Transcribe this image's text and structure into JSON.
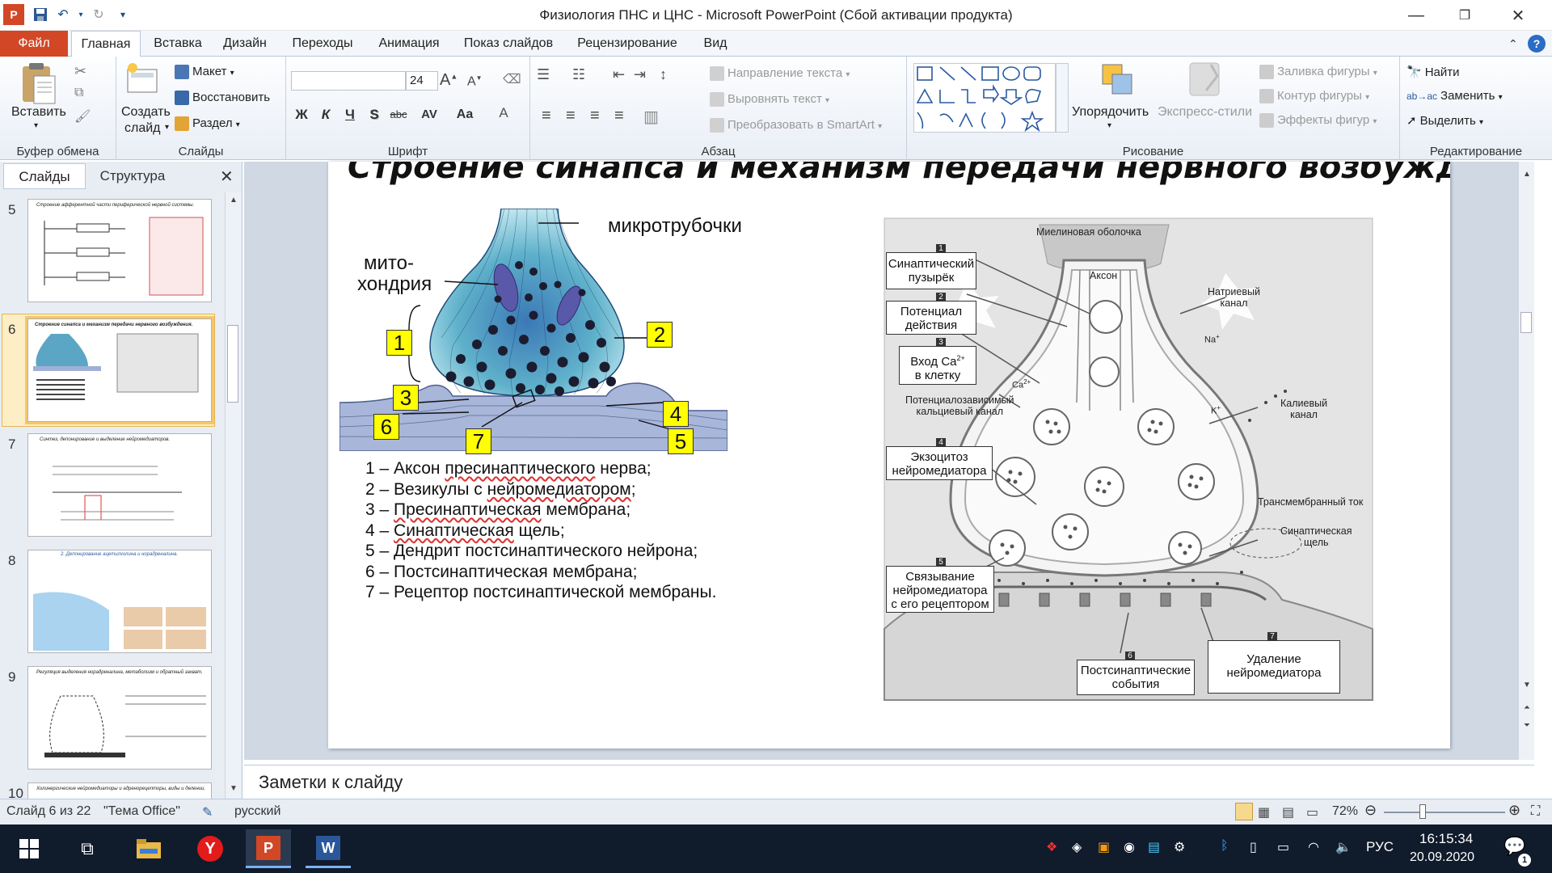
{
  "window": {
    "title": "Физиология ПНС и ЦНС  -  Microsoft PowerPoint (Сбой активации продукта)"
  },
  "tabs": [
    {
      "label": "Файл"
    },
    {
      "label": "Главная"
    },
    {
      "label": "Вставка"
    },
    {
      "label": "Дизайн"
    },
    {
      "label": "Переходы"
    },
    {
      "label": "Анимация"
    },
    {
      "label": "Показ слайдов"
    },
    {
      "label": "Рецензирование"
    },
    {
      "label": "Вид"
    }
  ],
  "ribbon": {
    "clipboard": {
      "paste": "Вставить",
      "label": "Буфер обмена"
    },
    "slides": {
      "new_slide_1": "Создать",
      "new_slide_2": "слайд",
      "layout": "Макет",
      "reset": "Восстановить",
      "section": "Раздел",
      "label": "Слайды"
    },
    "font": {
      "size": "24",
      "label": "Шрифт",
      "bold": "Ж",
      "italic": "К",
      "underline": "Ч",
      "shadow": "S",
      "strike": "abc",
      "spacing": "AV",
      "case": "Aa",
      "color": "A"
    },
    "paragraph": {
      "text_direction": "Направление текста",
      "align_text": "Выровнять текст",
      "smartart": "Преобразовать в SmartArt",
      "label": "Абзац"
    },
    "drawing": {
      "arrange": "Упорядочить",
      "styles": "Экспресс-стили",
      "fill": "Заливка фигуры",
      "outline": "Контур фигуры",
      "effects": "Эффекты фигур",
      "label": "Рисование"
    },
    "editing": {
      "find": "Найти",
      "replace": "Заменить",
      "select": "Выделить",
      "label": "Редактирование"
    }
  },
  "left_panel": {
    "tab_slides": "Слайды",
    "tab_outline": "Структура",
    "slides": [
      {
        "num": "5",
        "title": "Строение афферентной части периферической нервной системы."
      },
      {
        "num": "6",
        "title": "Строение синапса и механизм передачи нервного возбуждения."
      },
      {
        "num": "7",
        "title": "Синтез, депонирование и выделение нейромедиаторов."
      },
      {
        "num": "8",
        "title": "2. Депонирование ацетилхолина и норадреналина."
      },
      {
        "num": "9",
        "title": "Регуляция выделения норадреналина, метаболизм и обратный захват."
      },
      {
        "num": "10",
        "title": "Холинергические нейромедиаторы и адренорецепторы, виды и делении."
      }
    ]
  },
  "slide": {
    "title": "Строение синапса и механизм передачи нервного возбуждения.",
    "left_diagram": {
      "microtubules": "микротрубочки",
      "mito_1": "мито-",
      "mito_2": "хондрия",
      "n1": "1",
      "n2": "2",
      "n3": "3",
      "n4": "4",
      "n5": "5",
      "n6": "6",
      "n7": "7"
    },
    "legend": [
      {
        "num": "1",
        "pre": "Аксон ",
        "ul": "пресинаптического",
        "post": " нерва;"
      },
      {
        "num": "2",
        "pre": "Везикулы с ",
        "ul": "нейромедиатором",
        "post": ";"
      },
      {
        "num": "3",
        "pre": "",
        "ul": "Пресинаптическая",
        "post": " мембрана;"
      },
      {
        "num": "4",
        "pre": "",
        "ul": "Синаптическая",
        "post": " щель;"
      },
      {
        "num": "5",
        "pre": "Дендрит постсинаптического нейрона;",
        "ul": "",
        "post": ""
      },
      {
        "num": "6",
        "pre": "Постсинаптическая мембрана;",
        "ul": "",
        "post": ""
      },
      {
        "num": "7",
        "pre": "Рецептор постсинаптической мембраны.",
        "ul": "",
        "post": ""
      }
    ],
    "right_diagram": {
      "myelin": "Миелиновая оболочка",
      "axon": "Аксон",
      "b1_1": "Синаптический",
      "b1_2": "пузырёк",
      "b2_1": "Потенциал",
      "b2_2": "действия",
      "b3_1": "Вход Ca",
      "b3_sup": "2+",
      "b3_2": "в клетку",
      "b4_1": "Экзоцитоз",
      "b4_2": "нейромедиатора",
      "b5_1": "Связывание",
      "b5_2": "нейромедиатора",
      "b5_3": "с его рецептором",
      "b6_1": "Постсинаптические",
      "b6_2": "события",
      "b7_1": "Удаление",
      "b7_2": "нейромедиатора",
      "n1": "1",
      "n2": "2",
      "n3": "3",
      "n4": "4",
      "n5": "5",
      "n6": "6",
      "n7": "7",
      "na_channel_1": "Натриевый",
      "na_channel_2": "канал",
      "na": "Na",
      "ca": "Ca",
      "ca_channel_1": "Потенциалозависимый",
      "ca_channel_2": "кальциевый канал",
      "k_channel_1": "Калиевый",
      "k_channel_2": "канал",
      "k": "K",
      "transmembrane": "Трансмембранный ток",
      "cleft_1": "Синаптическая",
      "cleft_2": "щель"
    }
  },
  "notes": "Заметки к слайду",
  "status": {
    "slide_of": "Слайд 6 из 22",
    "theme": "\"Тема Office\"",
    "language": "русский",
    "zoom": "72%"
  },
  "taskbar": {
    "lang": "РУС",
    "time": "16:15:34",
    "date": "20.09.2020",
    "notif_count": "1"
  },
  "colors": {
    "file_tab": "#d24726",
    "ribbon_border": "#b9c9de",
    "taskbar": "#101b2c",
    "highlight": "#ffff00"
  }
}
